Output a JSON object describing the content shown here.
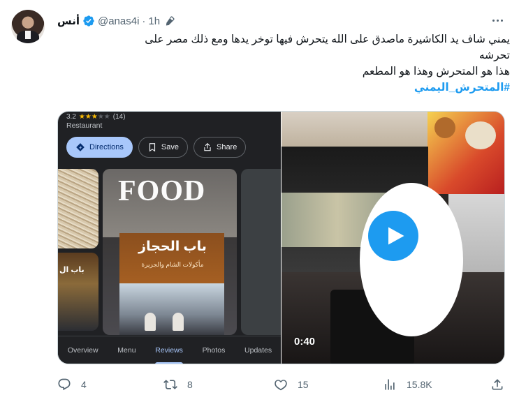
{
  "author": {
    "display_name": "أنس",
    "handle": "@anas4i",
    "separator": "·",
    "time": "1h"
  },
  "tweet": {
    "line1": "يمني شاف يد الكاشيرة ماصدق على الله يتحرش فيها توخر يدها ومع ذلك مصر على",
    "line2": "تحرشه",
    "line3": "هذا هو المتحرش وهذا هو المطعم",
    "hashtag": "#المتحرش_اليمني"
  },
  "maps_card": {
    "rating": "3.2",
    "stars": "★★★",
    "stars_off": "★★",
    "review_count": "(14)",
    "category": "Restaurant",
    "buttons": {
      "directions": "Directions",
      "save": "Save",
      "share": "Share"
    },
    "photo": {
      "food_sign": "FOOD",
      "shop_sign": "باب الحجاز",
      "shop_sub": "مأكولات الشام والجزيرة",
      "side_sign": "باب ال"
    },
    "tabs": [
      "Overview",
      "Menu",
      "Reviews",
      "Photos",
      "Updates"
    ],
    "active_tab": "Reviews"
  },
  "video": {
    "duration": "0:40"
  },
  "actions": {
    "replies": "4",
    "retweets": "8",
    "likes": "15",
    "views": "15.8K"
  },
  "colors": {
    "accent": "#1d9bf0",
    "text": "#0f1419",
    "muted": "#536471",
    "maps_primary": "#a8c7fa"
  }
}
